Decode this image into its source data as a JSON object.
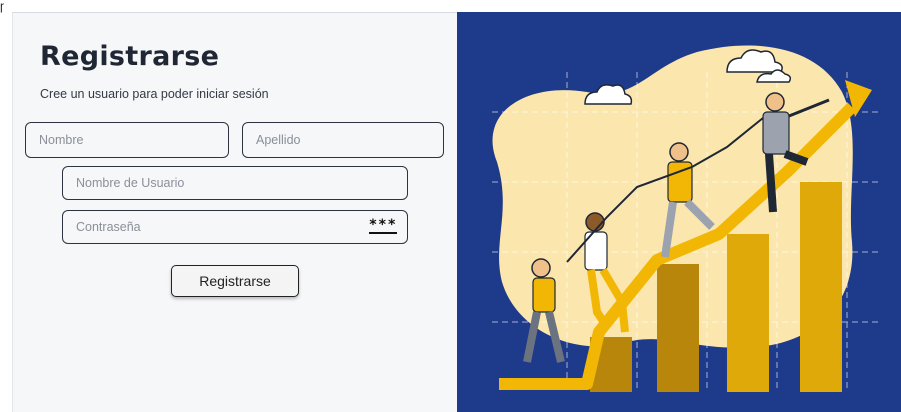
{
  "page": {
    "title": "Registrarse",
    "subtitle": "Cree un usuario para poder iniciar sesión"
  },
  "form": {
    "first_name": {
      "placeholder": "Nombre",
      "value": ""
    },
    "last_name": {
      "placeholder": "Apellido",
      "value": ""
    },
    "username": {
      "placeholder": "Nombre de Usuario",
      "value": ""
    },
    "password": {
      "placeholder": "Contraseña",
      "value": "",
      "toggle_icon": "password-dots-icon",
      "toggle_glyph": "***"
    },
    "submit_label": "Registrarse"
  },
  "illustration": {
    "subject": "team-climbing-growth-chart",
    "background_color": "#1e3a8a",
    "blob_color": "#fbe6ad",
    "bar_color": "#e0a90a"
  }
}
